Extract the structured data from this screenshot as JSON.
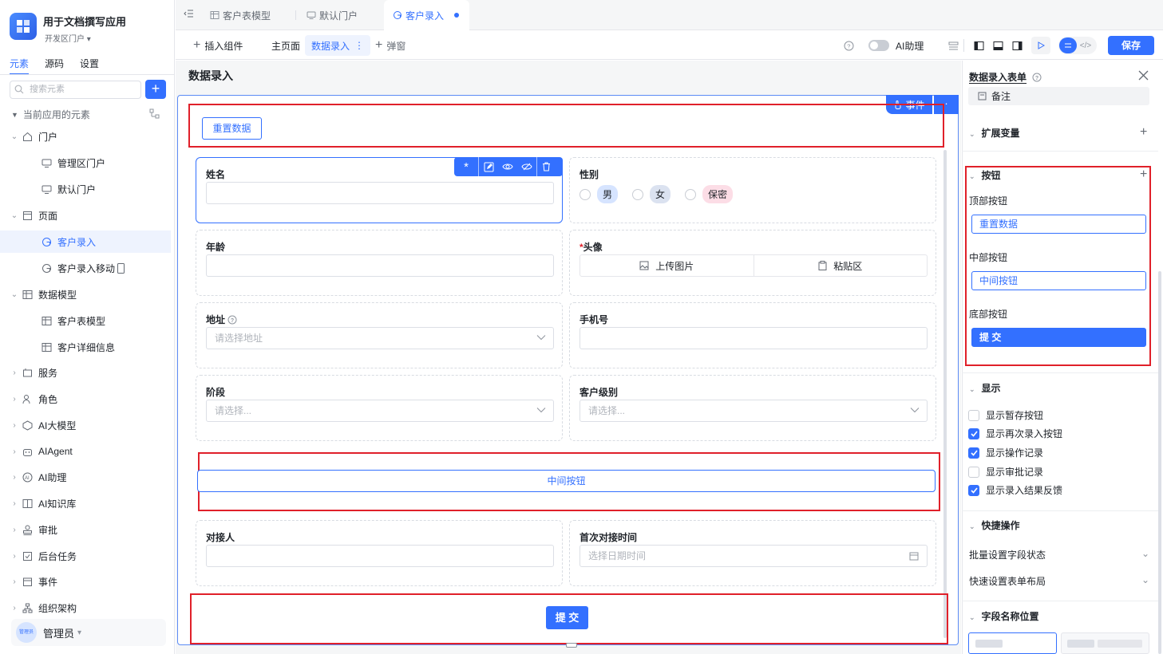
{
  "app": {
    "title": "用于文档撰写应用",
    "portal": "开发区门户"
  },
  "sidebar": {
    "tabs": [
      "元素",
      "源码",
      "设置"
    ],
    "search_placeholder": "搜索元素",
    "section_title": "当前应用的元素",
    "items": [
      {
        "label": "门户",
        "icon": "portal-icon"
      },
      {
        "label": "管理区门户",
        "icon": "monitor-icon"
      },
      {
        "label": "默认门户",
        "icon": "monitor-icon"
      },
      {
        "label": "页面",
        "icon": "page-icon"
      },
      {
        "label": "客户录入",
        "icon": "form-icon"
      },
      {
        "label": "客户录入移动",
        "icon": "form-icon"
      },
      {
        "label": "数据模型",
        "icon": "table-icon"
      },
      {
        "label": "客户表模型",
        "icon": "table-icon"
      },
      {
        "label": "客户详细信息",
        "icon": "table-icon"
      },
      {
        "label": "服务",
        "icon": "service-icon"
      },
      {
        "label": "角色",
        "icon": "role-icon"
      },
      {
        "label": "AI大模型",
        "icon": "model-icon"
      },
      {
        "label": "AIAgent",
        "icon": "robot-icon"
      },
      {
        "label": "AI助理",
        "icon": "ai-icon"
      },
      {
        "label": "AI知识库",
        "icon": "book-icon"
      },
      {
        "label": "审批",
        "icon": "stamp-icon"
      },
      {
        "label": "后台任务",
        "icon": "task-icon"
      },
      {
        "label": "事件",
        "icon": "event-icon"
      },
      {
        "label": "组织架构",
        "icon": "org-icon"
      }
    ],
    "admin": {
      "name": "管理员",
      "avatar_text": "管理员"
    }
  },
  "top_tabs": [
    "客户表模型",
    "默认门户",
    "客户录入"
  ],
  "toolbar": {
    "insert": "插入组件",
    "main_page": "主页面",
    "data_entry": "数据录入",
    "popup": "弹窗",
    "ai_assistant": "AI助理",
    "save": "保存"
  },
  "canvas": {
    "page_title": "数据录入",
    "event_btn": "事件",
    "top_button": "重置数据",
    "fields": {
      "name": {
        "label": "姓名"
      },
      "gender": {
        "label": "性别",
        "options": [
          "男",
          "女",
          "保密"
        ]
      },
      "age": {
        "label": "年龄"
      },
      "avatar": {
        "label": "头像",
        "upload": "上传图片",
        "paste": "粘贴区"
      },
      "address": {
        "label": "地址",
        "placeholder": "请选择地址"
      },
      "phone": {
        "label": "手机号"
      },
      "stage": {
        "label": "阶段",
        "placeholder": "请选择..."
      },
      "level": {
        "label": "客户级别",
        "placeholder": "请选择..."
      },
      "contact": {
        "label": "对接人"
      },
      "first_time": {
        "label": "首次对接时间",
        "placeholder": "选择日期时间"
      }
    },
    "middle_button": "中间按钮",
    "submit_button": "提 交"
  },
  "right_panel": {
    "title": "数据录入表单",
    "remark": "备注",
    "ext_vars": "扩展变量",
    "buttons_section": "按钮",
    "top_btn_label": "顶部按钮",
    "top_btn_value": "重置数据",
    "mid_btn_label": "中部按钮",
    "mid_btn_value": "中间按钮",
    "bottom_btn_label": "底部按钮",
    "bottom_btn_value": "提 交",
    "display_section": "显示",
    "display_options": [
      {
        "label": "显示暂存按钮",
        "checked": false
      },
      {
        "label": "显示再次录入按钮",
        "checked": true
      },
      {
        "label": "显示操作记录",
        "checked": true
      },
      {
        "label": "显示审批记录",
        "checked": false
      },
      {
        "label": "显示录入结果反馈",
        "checked": true
      }
    ],
    "quick_section": "快捷操作",
    "batch_field": "批量设置字段状态",
    "quick_layout": "快速设置表单布局",
    "field_pos_section": "字段名称位置"
  },
  "colors": {
    "accent": "#3370ff",
    "highlight": "#e0202a"
  }
}
